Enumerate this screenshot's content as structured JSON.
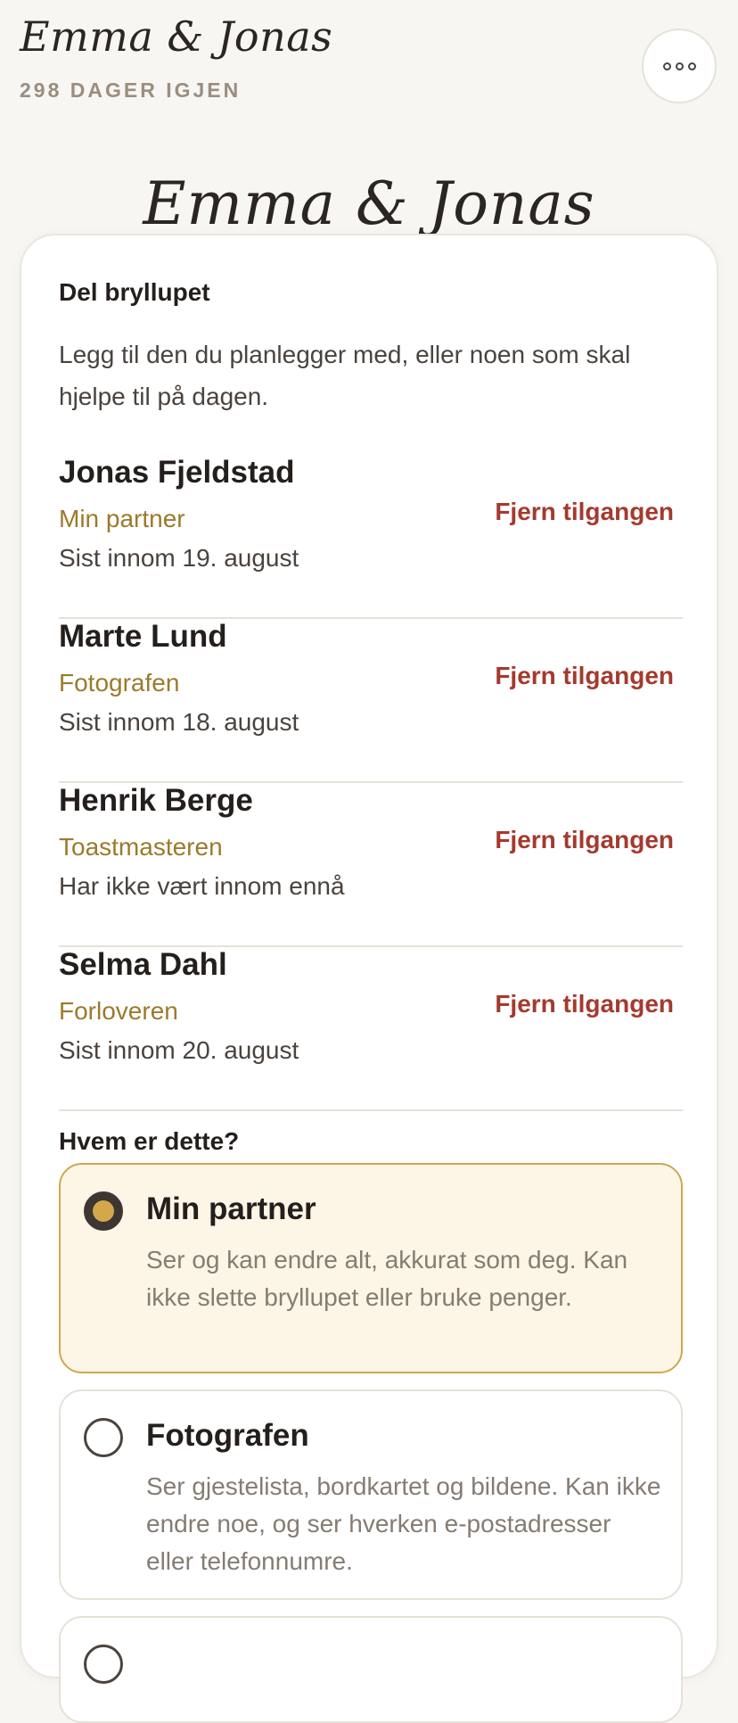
{
  "header": {
    "couple": "Emma & Jonas",
    "days_left": "298 DAGER IGJEN",
    "menu_icon": "more-horizontal-icon"
  },
  "hero": {
    "couple": "Emma & Jonas"
  },
  "share": {
    "title": "Del bryllupet",
    "intro": "Legg til den du planlegger med, eller noen som skal hjelpe til på dagen.",
    "remove_label": "Fjern tilgangen",
    "members": [
      {
        "name": "Jonas Fjeldstad",
        "role": "Min partner",
        "seen": "Sist innom 19. august"
      },
      {
        "name": "Marte Lund",
        "role": "Fotografen",
        "seen": "Sist innom 18. august"
      },
      {
        "name": "Henrik Berge",
        "role": "Toastmasteren",
        "seen": "Har ikke vært innom ennå"
      },
      {
        "name": "Selma Dahl",
        "role": "Forloveren",
        "seen": "Sist innom 20. august"
      }
    ]
  },
  "roles": {
    "title": "Hvem er dette?",
    "options": [
      {
        "title": "Min partner",
        "desc": "Ser og kan endre alt, akkurat som deg. Kan ikke slette bryllupet eller bruke penger.",
        "selected": true
      },
      {
        "title": "Fotografen",
        "desc": "Ser gjestelista, bordkartet og bildene. Kan ikke endre noe, og ser hverken e-postadresser eller telefonnumre.",
        "selected": false
      }
    ]
  },
  "colors": {
    "accent": "#d2a84a",
    "role_text": "#9c7a2b",
    "danger": "#a43a2e",
    "background": "#f7f6f3"
  }
}
